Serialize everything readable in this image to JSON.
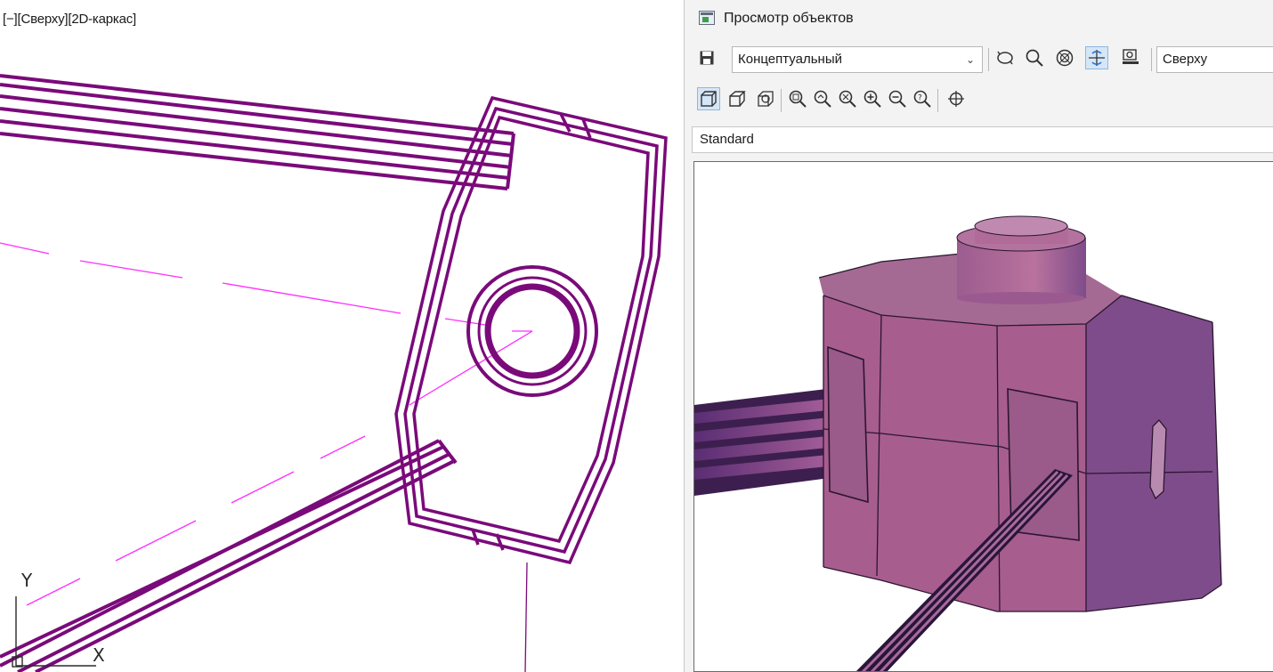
{
  "drawing": {
    "viewport_label": "[−][Сверху][2D-каркас]",
    "ucs": {
      "y_label": "Y",
      "x_label": "X"
    },
    "colors": {
      "geometry": "#7a0a7a",
      "centerline": "#ff2cff"
    }
  },
  "viewer": {
    "title": "Просмотр объектов",
    "toolbar": {
      "visual_style": "Концептуальный",
      "view": "Сверху",
      "icons": [
        "save-icon",
        "orbit-icon",
        "zoom-icon",
        "wheel-icon",
        "pan-icon",
        "camera-icon"
      ],
      "icons_row2": [
        "parallel-icon",
        "perspective-icon",
        "steering-icon",
        "zoom-window-icon",
        "zoom-realtime-icon",
        "zoom-extents-icon",
        "zoom-in-icon",
        "zoom-out-icon",
        "zoom-dynamic-icon",
        "pan-target-icon"
      ]
    },
    "ucs_bar": "Standard",
    "colors": {
      "model_front": "#a85d8f",
      "model_side": "#7f4c8b",
      "model_top": "#95628f"
    }
  }
}
